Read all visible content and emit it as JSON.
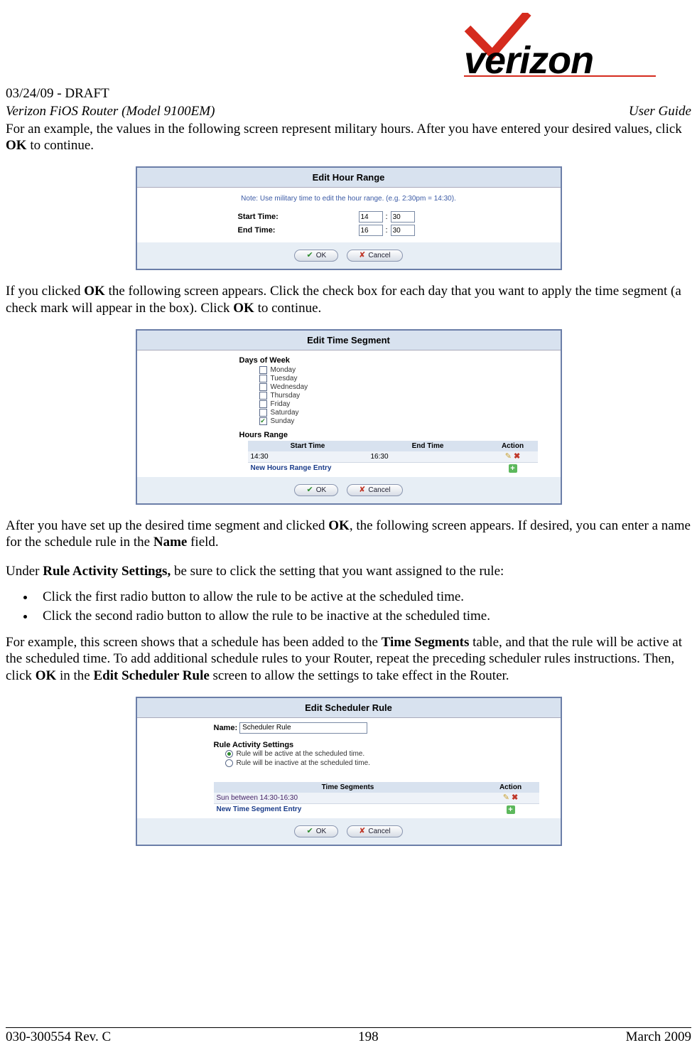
{
  "header": {
    "draft_line": "03/24/09 - DRAFT",
    "product": "Verizon FiOS Router (Model 9100EM)",
    "doc_type": "User Guide"
  },
  "para1_a": "For an example, the values in the following screen represent military hours. After you have entered your desired values, click ",
  "para1_b": "OK",
  "para1_c": " to continue.",
  "shot1": {
    "title": "Edit Hour Range",
    "note": "Note: Use military time to edit the hour range. (e.g. 2:30pm = 14:30).",
    "start_label": "Start Time:",
    "end_label": "End Time:",
    "start_h": "14",
    "start_m": "30",
    "end_h": "16",
    "end_m": "30",
    "ok": "OK",
    "cancel": "Cancel"
  },
  "para2_a": "If you clicked ",
  "para2_b": "OK",
  "para2_c": " the following screen appears. Click the check box for each day that you want to apply the time segment (a check mark will appear in the box). Click ",
  "para2_d": "OK",
  "para2_e": " to continue.",
  "shot2": {
    "title": "Edit Time Segment",
    "days_heading": "Days of Week",
    "days": [
      {
        "label": "Monday",
        "checked": false
      },
      {
        "label": "Tuesday",
        "checked": false
      },
      {
        "label": "Wednesday",
        "checked": false
      },
      {
        "label": "Thursday",
        "checked": false
      },
      {
        "label": "Friday",
        "checked": false
      },
      {
        "label": "Saturday",
        "checked": false
      },
      {
        "label": "Sunday",
        "checked": true
      }
    ],
    "hours_heading": "Hours Range",
    "col_start": "Start Time",
    "col_end": "End Time",
    "col_action": "Action",
    "row_start": "14:30",
    "row_end": "16:30",
    "new_entry": "New Hours Range Entry",
    "ok": "OK",
    "cancel": "Cancel"
  },
  "para3_a": "After you have set up the desired time segment and clicked ",
  "para3_b": "OK",
  "para3_c": ", the following screen appears. If desired, you can enter a name for the schedule rule in the ",
  "para3_d": "Name",
  "para3_e": " field.",
  "para4_a": "Under ",
  "para4_b": "Rule Activity Settings,",
  "para4_c": " be sure to click the setting that you want assigned to the rule:",
  "bullets": {
    "b1": "Click the first radio button to allow the rule to be active at the scheduled time.",
    "b2": "Click the second radio button to allow the  rule to be inactive at the scheduled time."
  },
  "para5_a": "For example, this screen shows that a schedule has been added to the ",
  "para5_b": "Time Segments",
  "para5_c": " table, and that the rule will be active at the scheduled time. To add additional schedule rules to your Router, repeat the preceding scheduler rules instructions. Then, click ",
  "para5_d": "OK",
  "para5_e": " in the ",
  "para5_f": "Edit Scheduler Rule",
  "para5_g": " screen to allow the settings to take effect in the Router.",
  "shot3": {
    "title": "Edit Scheduler Rule",
    "name_label": "Name:",
    "name_value": "Scheduler Rule",
    "ras_heading": "Rule Activity Settings",
    "radio1": "Rule will be active at the scheduled time.",
    "radio2": "Rule will be inactive at the scheduled time.",
    "col_ts": "Time Segments",
    "col_action": "Action",
    "row_seg": "Sun between 14:30-16:30",
    "new_entry": "New Time Segment Entry",
    "ok": "OK",
    "cancel": "Cancel"
  },
  "footer": {
    "left": "030-300554 Rev. C",
    "center": "198",
    "right": "March 2009"
  }
}
